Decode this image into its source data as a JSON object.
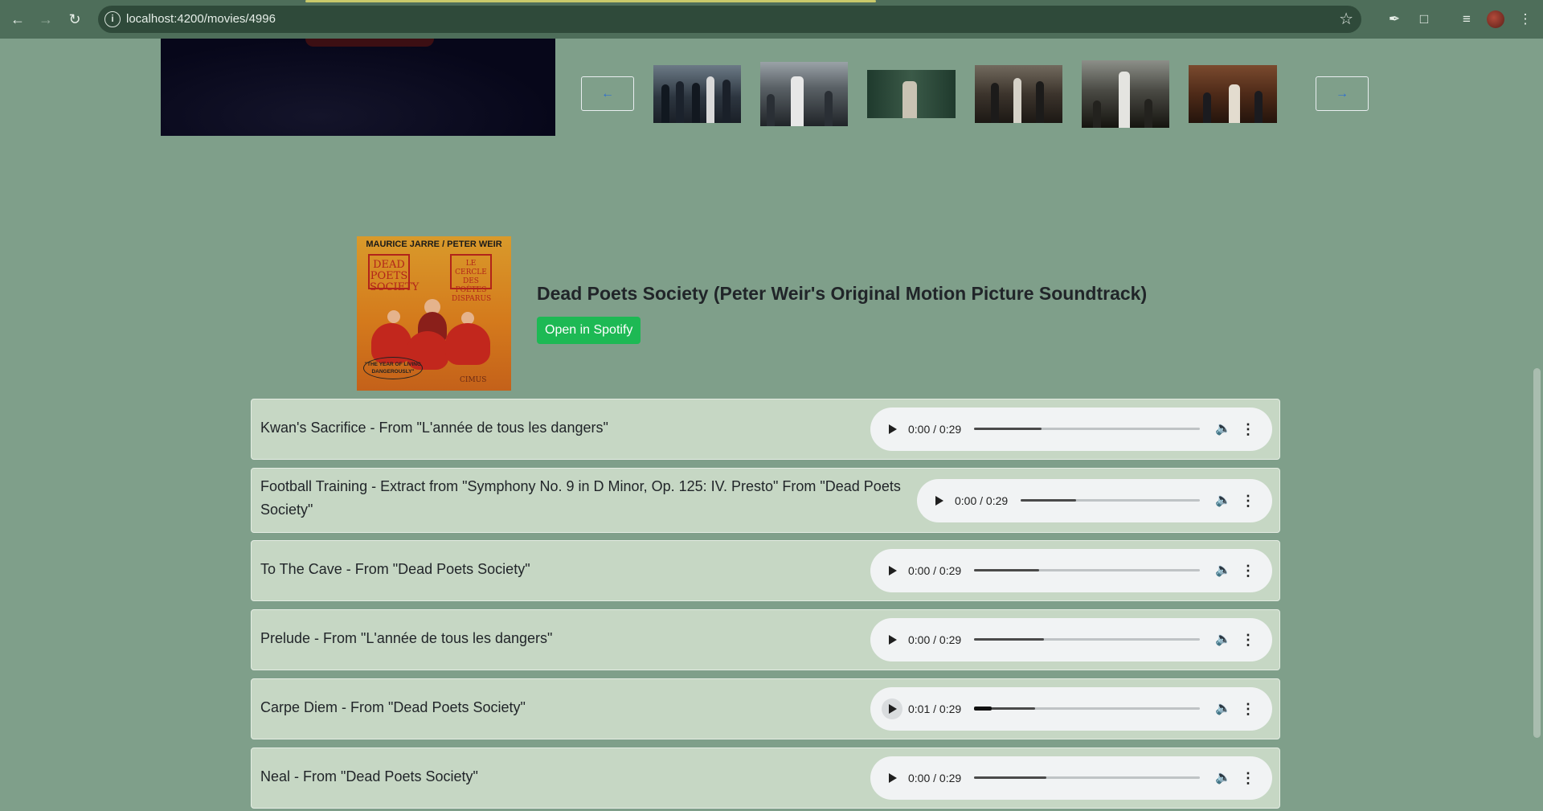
{
  "browser": {
    "url": "localhost:4200/movies/4996"
  },
  "gallery": {
    "prev_label": "←",
    "next_label": "→"
  },
  "album": {
    "title": "Dead Poets Society (Peter Weir's Original Motion Picture Soundtrack)",
    "spotify_label": "Open in Spotify",
    "cover": {
      "top_text": "MAURICE JARRE / PETER WEIR",
      "box_left": "DEAD POETS SOCIETY",
      "box_right": "LE CERCLE DES POÈTES DISPARUS",
      "quote": "\"THE YEAR OF LIVING DANGEROUSLY\"",
      "logo": "CIMUS"
    }
  },
  "tracks": [
    {
      "name": "Kwan's Sacrifice - From \"L'année de tous les dangers\"",
      "time": "0:00 / 0:29",
      "progress": 0.3
    },
    {
      "name": "Football Training - Extract from \"Symphony No. 9 in D Minor, Op. 125: IV. Presto\" From \"Dead Poets Society\"",
      "time": "0:00 / 0:29",
      "progress": 0.31
    },
    {
      "name": "To The Cave - From \"Dead Poets Society\"",
      "time": "0:00 / 0:29",
      "progress": 0.29
    },
    {
      "name": "Prelude - From \"L'année de tous les dangers\"",
      "time": "0:00 / 0:29",
      "progress": 0.31
    },
    {
      "name": "Carpe Diem - From \"Dead Poets Society\"",
      "time": "0:01 / 0:29",
      "progress": 0.27,
      "played": 0.08
    },
    {
      "name": "Neal - From \"Dead Poets Society\"",
      "time": "0:00 / 0:29",
      "progress": 0.32
    }
  ],
  "icons": {
    "back": "arrow-left-icon",
    "forward": "arrow-right-icon",
    "reload": "reload-icon",
    "info": "info-icon",
    "star": "star-icon",
    "play": "play-icon",
    "volume": "volume-icon",
    "more": "more-vert-icon"
  }
}
